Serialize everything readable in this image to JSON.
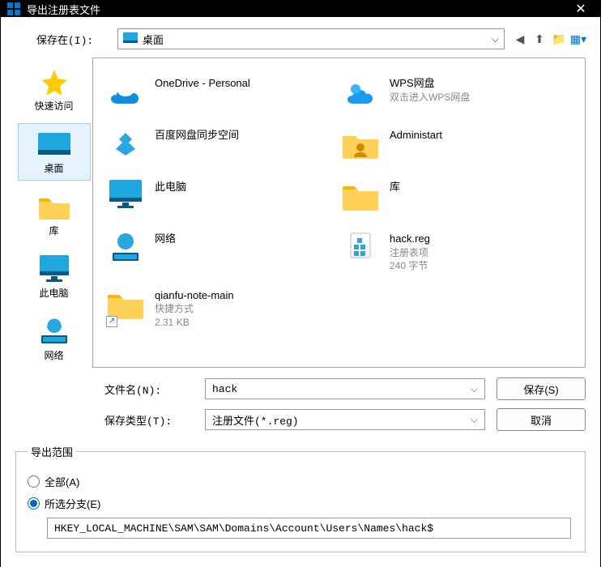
{
  "title": "导出注册表文件",
  "savein_label": "保存在(I):",
  "location_name": "桌面",
  "sidebar": {
    "items": [
      {
        "label": "快速访问"
      },
      {
        "label": "桌面"
      },
      {
        "label": "库"
      },
      {
        "label": "此电脑"
      },
      {
        "label": "网络"
      }
    ]
  },
  "files": [
    {
      "name": "OneDrive - Personal",
      "sub1": "",
      "sub2": ""
    },
    {
      "name": "WPS网盘",
      "sub1": "双击进入WPS网盘",
      "sub2": ""
    },
    {
      "name": "百度网盘同步空间",
      "sub1": "",
      "sub2": ""
    },
    {
      "name": "Administart",
      "sub1": "",
      "sub2": ""
    },
    {
      "name": "此电脑",
      "sub1": "",
      "sub2": ""
    },
    {
      "name": "库",
      "sub1": "",
      "sub2": ""
    },
    {
      "name": "网络",
      "sub1": "",
      "sub2": ""
    },
    {
      "name": "hack.reg",
      "sub1": "注册表项",
      "sub2": "240 字节"
    },
    {
      "name": "qianfu-note-main",
      "sub1": "快捷方式",
      "sub2": "2.31 KB"
    }
  ],
  "filename_label": "文件名(N):",
  "filename_value": "hack",
  "filetype_label": "保存类型(T):",
  "filetype_value": "注册文件(*.reg)",
  "save_btn": "保存(S)",
  "cancel_btn": "取消",
  "export_range": {
    "legend": "导出范围",
    "all_label": "全部(A)",
    "branch_label": "所选分支(E)",
    "branch_value": "HKEY_LOCAL_MACHINE\\SAM\\SAM\\Domains\\Account\\Users\\Names\\hack$"
  }
}
